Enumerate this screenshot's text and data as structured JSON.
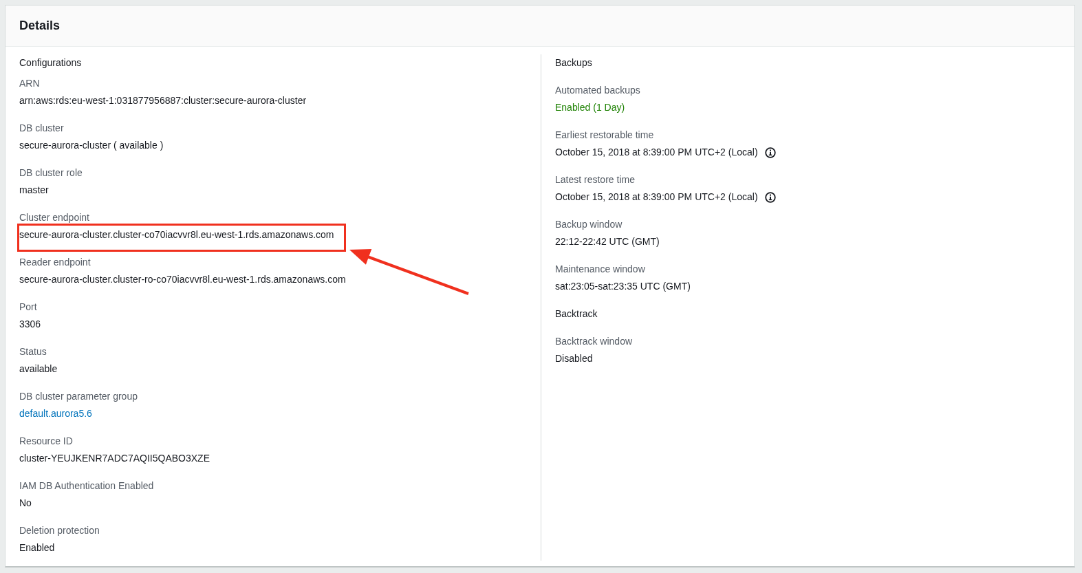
{
  "panel": {
    "title": "Details"
  },
  "columns": [
    {
      "sections": [
        {
          "heading": "Configurations",
          "fields": [
            {
              "label": "ARN",
              "value": "arn:aws:rds:eu-west-1:031877956887:cluster:secure-aurora-cluster",
              "kind": "plain"
            },
            {
              "label": "DB cluster",
              "value": "secure-aurora-cluster ( available )",
              "kind": "plain"
            },
            {
              "label": "DB cluster role",
              "value": "master",
              "kind": "plain"
            },
            {
              "label": "Cluster endpoint",
              "value": "secure-aurora-cluster.cluster-co70iacvvr8l.eu-west-1.rds.amazonaws.com",
              "kind": "plain",
              "highlighted": true
            },
            {
              "label": "Reader endpoint",
              "value": "secure-aurora-cluster.cluster-ro-co70iacvvr8l.eu-west-1.rds.amazonaws.com",
              "kind": "plain"
            },
            {
              "label": "Port",
              "value": "3306",
              "kind": "plain"
            },
            {
              "label": "Status",
              "value": "available",
              "kind": "plain"
            },
            {
              "label": "DB cluster parameter group",
              "value": "default.aurora5.6",
              "kind": "link"
            },
            {
              "label": "Resource ID",
              "value": "cluster-YEUJKENR7ADC7AQII5QABO3XZE",
              "kind": "plain"
            },
            {
              "label": "IAM DB Authentication Enabled",
              "value": "No",
              "kind": "plain"
            },
            {
              "label": "Deletion protection",
              "value": "Enabled",
              "kind": "plain"
            }
          ]
        }
      ]
    },
    {
      "sections": [
        {
          "heading": "Backups",
          "fields": [
            {
              "label": "Automated backups",
              "value": "Enabled (1 Day)",
              "kind": "success"
            },
            {
              "label": "Earliest restorable time",
              "value": "October 15, 2018 at 8:39:00 PM UTC+2 (Local)",
              "kind": "plain",
              "info": true
            },
            {
              "label": "Latest restore time",
              "value": "October 15, 2018 at 8:39:00 PM UTC+2 (Local)",
              "kind": "plain",
              "info": true
            },
            {
              "label": "Backup window",
              "value": "22:12-22:42 UTC (GMT)",
              "kind": "plain"
            },
            {
              "label": "Maintenance window",
              "value": "sat:23:05-sat:23:35 UTC (GMT)",
              "kind": "plain"
            }
          ]
        },
        {
          "heading": "Backtrack",
          "fields": [
            {
              "label": "Backtrack window",
              "value": "Disabled",
              "kind": "plain"
            }
          ]
        }
      ]
    }
  ]
}
